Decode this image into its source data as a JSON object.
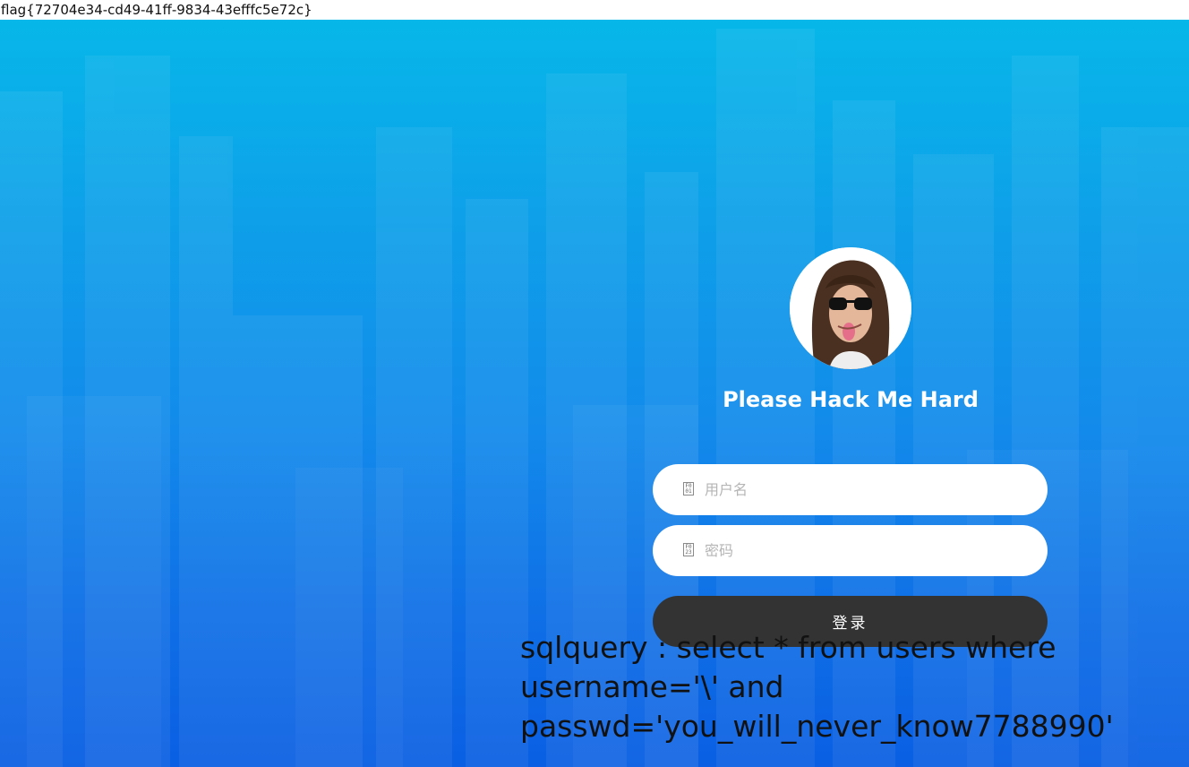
{
  "flag_text": "flag{72704e34-cd49-41ff-9834-43efffc5e72c}",
  "login": {
    "title": "Please Hack Me Hard",
    "username_placeholder": "用户名",
    "password_placeholder": "密码",
    "username_icon": "user-icon",
    "password_icon": "lock-icon",
    "submit_label": "登录"
  },
  "sql_output": {
    "line1": "sqlquery : select * from users where",
    "line2": "username='\\' and",
    "line3": "passwd='you_will_never_know7788990'"
  },
  "colors": {
    "background_top": "#07b7e9",
    "background_bottom": "#0a5fe3",
    "button": "#333333",
    "field": "#ffffff",
    "title": "#ffffff"
  }
}
